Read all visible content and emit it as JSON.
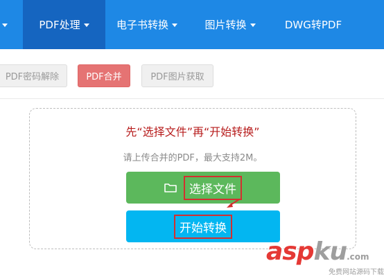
{
  "nav": {
    "items": [
      {
        "label": ""
      },
      {
        "label": "PDF处理"
      },
      {
        "label": "电子书转换"
      },
      {
        "label": "图片转换"
      },
      {
        "label": "DWG转PDF"
      }
    ]
  },
  "subtabs": [
    {
      "label": "PDF密码解除"
    },
    {
      "label": "PDF合并"
    },
    {
      "label": "PDF图片获取"
    }
  ],
  "upload": {
    "instruction": "先“选择文件”再“开始转换”",
    "note": "请上传合并的PDF，最大支持2M。",
    "select_label": "选择文件",
    "start_label": "开始转换"
  },
  "watermark": {
    "logo_a": "asp",
    "logo_k": "ku",
    "logo_dot": ".com",
    "tagline": "免费网站源码下载站!"
  },
  "colors": {
    "nav_bg": "#1e88e5",
    "nav_active": "#1565c0",
    "tab_active": "#e57373",
    "select_button": "#5cb85c",
    "start_button": "#03b6f1",
    "instruction_text": "#b71c1c",
    "highlight": "#d32f2f"
  },
  "icons": {
    "select": "folder-icon"
  }
}
